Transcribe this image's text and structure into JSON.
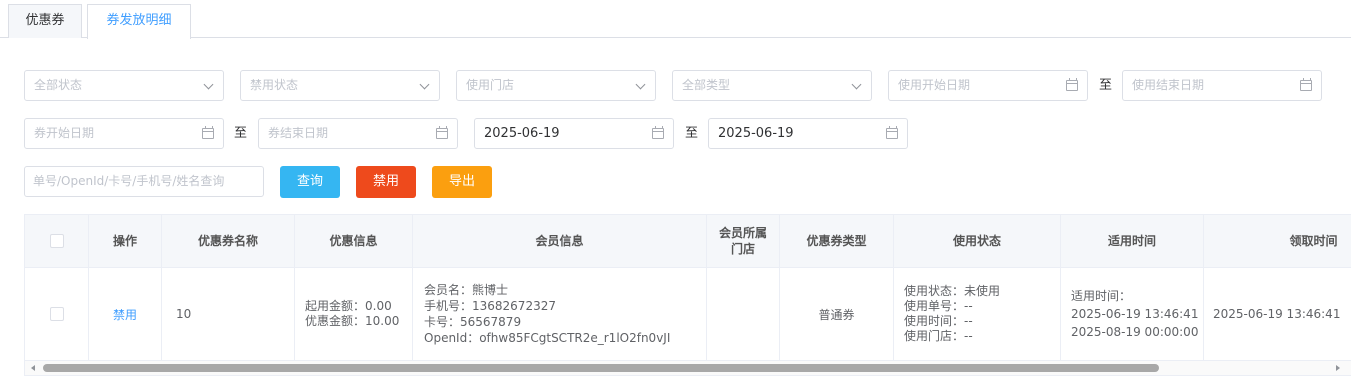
{
  "tabs": [
    {
      "label": "优惠券",
      "active": false
    },
    {
      "label": "券发放明细",
      "active": true
    }
  ],
  "filters": {
    "status": "全部状态",
    "disable_status": "禁用状态",
    "store": "使用门店",
    "type": "全部类型",
    "use_start": "使用开始日期",
    "use_end": "使用结束日期",
    "coupon_start": "券开始日期",
    "coupon_end": "券结束日期",
    "issue_start": "2025-06-19",
    "issue_end": "2025-06-19",
    "to_label": "至",
    "search_placeholder": "单号/OpenId/卡号/手机号/姓名查询"
  },
  "buttons": {
    "query": "查询",
    "disable": "禁用",
    "export": "导出"
  },
  "table": {
    "columns": [
      "操作",
      "优惠券名称",
      "优惠信息",
      "会员信息",
      "会员所属门店",
      "优惠券类型",
      "使用状态",
      "适用时间",
      "领取时间"
    ],
    "column_store_lines": [
      "会员所属",
      "门店"
    ],
    "row": {
      "action": "禁用",
      "name": "10",
      "discount": [
        "起用金额：0.00",
        "优惠金额：10.00"
      ],
      "member": [
        "会员名：熊博士",
        "手机号：13682672327",
        "卡号：56567879",
        "OpenId：ofhw85FCgtSCTR2e_r1lO2fn0vJI"
      ],
      "store": "",
      "type": "普通券",
      "status": [
        "使用状态：未使用",
        "使用单号：--",
        "使用时间：--",
        "使用门店：--"
      ],
      "valid": [
        "适用时间：",
        "2025-06-19 13:46:41",
        "2025-08-19 00:00:00"
      ],
      "received": "2025-06-19 13:46:41"
    }
  }
}
